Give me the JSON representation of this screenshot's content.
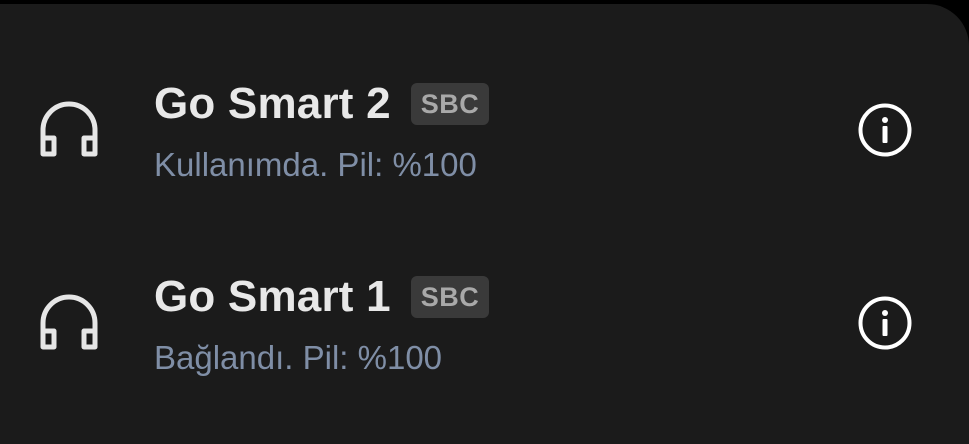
{
  "devices": [
    {
      "name": "Go Smart 2",
      "codec": "SBC",
      "status": "Kullanımda. Pil: %100",
      "icon": "headphones-icon"
    },
    {
      "name": "Go Smart 1",
      "codec": "SBC",
      "status": "Bağlandı. Pil: %100",
      "icon": "headphones-icon"
    }
  ],
  "colors": {
    "background": "#1b1b1b",
    "name": "#e8e8e8",
    "status": "#7f8ea6",
    "badge_bg": "#3a3a3a",
    "badge_text": "#a9a9a9"
  }
}
